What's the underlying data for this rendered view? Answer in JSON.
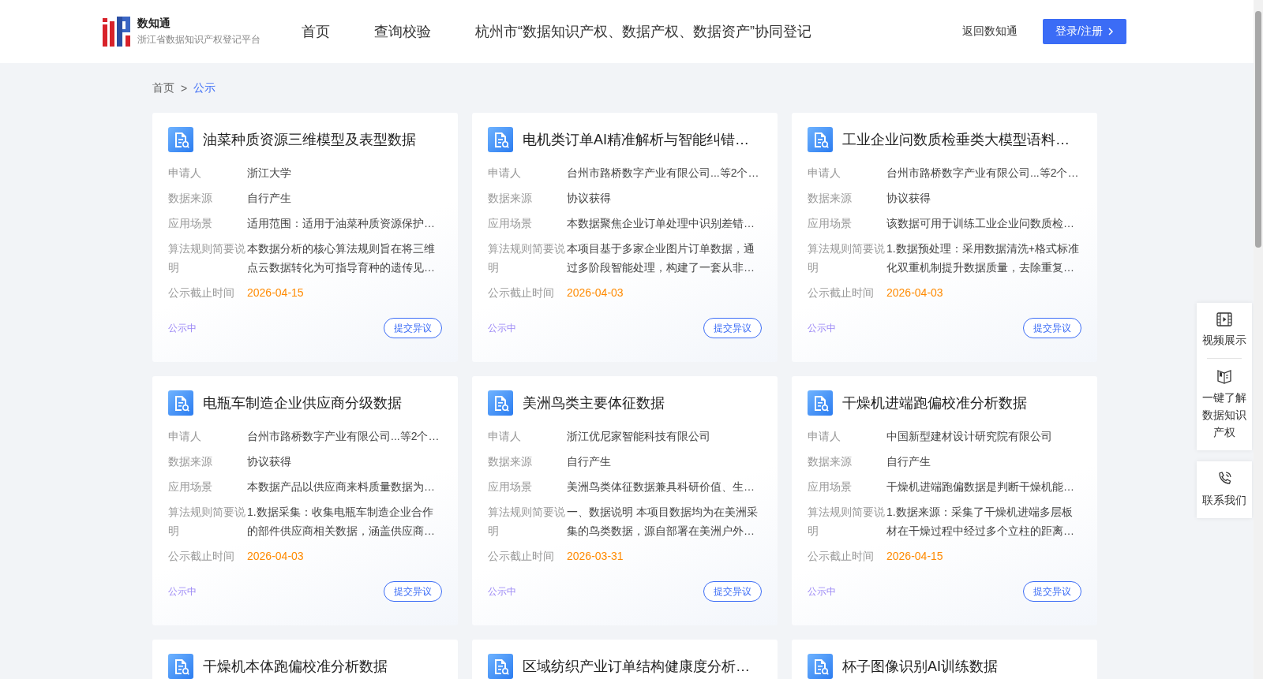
{
  "header": {
    "brand": "数知通",
    "subtitle": "浙江省数据知识产权登记平台",
    "nav": [
      {
        "label": "首页",
        "selected": false
      },
      {
        "label": "查询校验",
        "selected": false
      },
      {
        "label": "杭州市“数据知识产权、数据产权、数据资产”协同登记",
        "selected": false
      }
    ],
    "back_link": "返回数知通",
    "login_button": "登录/注册"
  },
  "breadcrumb": [
    {
      "label": "首页",
      "selected": false
    },
    {
      "label": "公示",
      "selected": true
    }
  ],
  "breadcrumb_separator": ">",
  "cards": [
    {
      "title": "油菜种质资源三维模型及表型数据",
      "status": "公示中",
      "action": "提交异议",
      "fields": [
        {
          "label": "申请人",
          "kind": "text",
          "lines": [
            "浙江大学"
          ]
        },
        {
          "label": "数据来源",
          "kind": "text",
          "lines": [
            "自行产生"
          ]
        },
        {
          "label": "应用场景",
          "kind": "text",
          "lines": [
            "适用范围：适用于油菜种质资源保护…"
          ]
        },
        {
          "label": "算法规则简要说明",
          "kind": "text",
          "lines": [
            "本数据分析的核心算法规则旨在将三维",
            "点云数据转化为可指导育种的遗传见…"
          ]
        },
        {
          "label": "公示截止时间",
          "kind": "date",
          "lines": [
            "2026-04-15"
          ]
        }
      ]
    },
    {
      "title": "电机类订单AI精准解析与智能纠错…",
      "status": "公示中",
      "action": "提交异议",
      "fields": [
        {
          "label": "申请人",
          "kind": "text",
          "lines": [
            "台州市路桥数字产业有限公司...等2个…"
          ]
        },
        {
          "label": "数据来源",
          "kind": "text",
          "lines": [
            "协议获得"
          ]
        },
        {
          "label": "应用场景",
          "kind": "text",
          "lines": [
            "本数据聚焦企业订单处理中识别差错…"
          ]
        },
        {
          "label": "算法规则简要说明",
          "kind": "text",
          "lines": [
            "本项目基于多家企业图片订单数据，通",
            "过多阶段智能处理，构建了一套从非…"
          ]
        },
        {
          "label": "公示截止时间",
          "kind": "date",
          "lines": [
            "2026-04-03"
          ]
        }
      ]
    },
    {
      "title": "工业企业问数质检垂类大模型语料…",
      "status": "公示中",
      "action": "提交异议",
      "fields": [
        {
          "label": "申请人",
          "kind": "text",
          "lines": [
            "台州市路桥数字产业有限公司...等2个…"
          ]
        },
        {
          "label": "数据来源",
          "kind": "text",
          "lines": [
            "协议获得"
          ]
        },
        {
          "label": "应用场景",
          "kind": "text",
          "lines": [
            "该数据可用于训练工业企业问数质检…"
          ]
        },
        {
          "label": "算法规则简要说明",
          "kind": "text",
          "lines": [
            "1.数据预处理：采用数据清洗+格式标准",
            "化双重机制提升数据质量，去除重复…"
          ]
        },
        {
          "label": "公示截止时间",
          "kind": "date",
          "lines": [
            "2026-04-03"
          ]
        }
      ]
    },
    {
      "title": "电瓶车制造企业供应商分级数据",
      "status": "公示中",
      "action": "提交异议",
      "fields": [
        {
          "label": "申请人",
          "kind": "text",
          "lines": [
            "台州市路桥数字产业有限公司...等2个…"
          ]
        },
        {
          "label": "数据来源",
          "kind": "text",
          "lines": [
            "协议获得"
          ]
        },
        {
          "label": "应用场景",
          "kind": "text",
          "lines": [
            "本数据产品以供应商来料质量数据为…"
          ]
        },
        {
          "label": "算法规则简要说明",
          "kind": "text",
          "lines": [
            "1.数据采集：收集电瓶车制造企业合作",
            "的部件供应商相关数据，涵盖供应商…"
          ]
        },
        {
          "label": "公示截止时间",
          "kind": "date",
          "lines": [
            "2026-04-03"
          ]
        }
      ]
    },
    {
      "title": "美洲鸟类主要体征数据",
      "status": "公示中",
      "action": "提交异议",
      "fields": [
        {
          "label": "申请人",
          "kind": "text",
          "lines": [
            "浙江优尼家智能科技有限公司"
          ]
        },
        {
          "label": "数据来源",
          "kind": "text",
          "lines": [
            "自行产生"
          ]
        },
        {
          "label": "应用场景",
          "kind": "text",
          "lines": [
            "美洲鸟类体征数据兼具科研价值、生…"
          ]
        },
        {
          "label": "算法规则简要说明",
          "kind": "text",
          "lines": [
            "一、数据说明 本项目数据均为在美洲采",
            "集的鸟类数据，源自部署在美洲户外…"
          ]
        },
        {
          "label": "公示截止时间",
          "kind": "date",
          "lines": [
            "2026-03-31"
          ]
        }
      ]
    },
    {
      "title": "干燥机进端跑偏校准分析数据",
      "status": "公示中",
      "action": "提交异议",
      "fields": [
        {
          "label": "申请人",
          "kind": "text",
          "lines": [
            "中国新型建材设计研究院有限公司"
          ]
        },
        {
          "label": "数据来源",
          "kind": "text",
          "lines": [
            "自行产生"
          ]
        },
        {
          "label": "应用场景",
          "kind": "text",
          "lines": [
            "干燥机进端跑偏数据是判断干燥机能…"
          ]
        },
        {
          "label": "算法规则简要说明",
          "kind": "text",
          "lines": [
            "1.数据来源：采集了干燥机进端多层板",
            "材在干燥过程中经过多个立柱的距离…"
          ]
        },
        {
          "label": "公示截止时间",
          "kind": "date",
          "lines": [
            "2026-04-15"
          ]
        }
      ]
    },
    {
      "title": "干燥机本体跑偏校准分析数据"
    },
    {
      "title": "区域纺织产业订单结构健康度分析…"
    },
    {
      "title": "杯子图像识别AI训练数据"
    }
  ],
  "side_panel": [
    {
      "kind": "video",
      "lines": [
        "视频展示"
      ]
    },
    {
      "kind": "book",
      "lines": [
        "一键了解",
        "数据知识",
        "产权"
      ]
    },
    {
      "kind": "phone",
      "lines": [
        "联系我们"
      ]
    }
  ]
}
